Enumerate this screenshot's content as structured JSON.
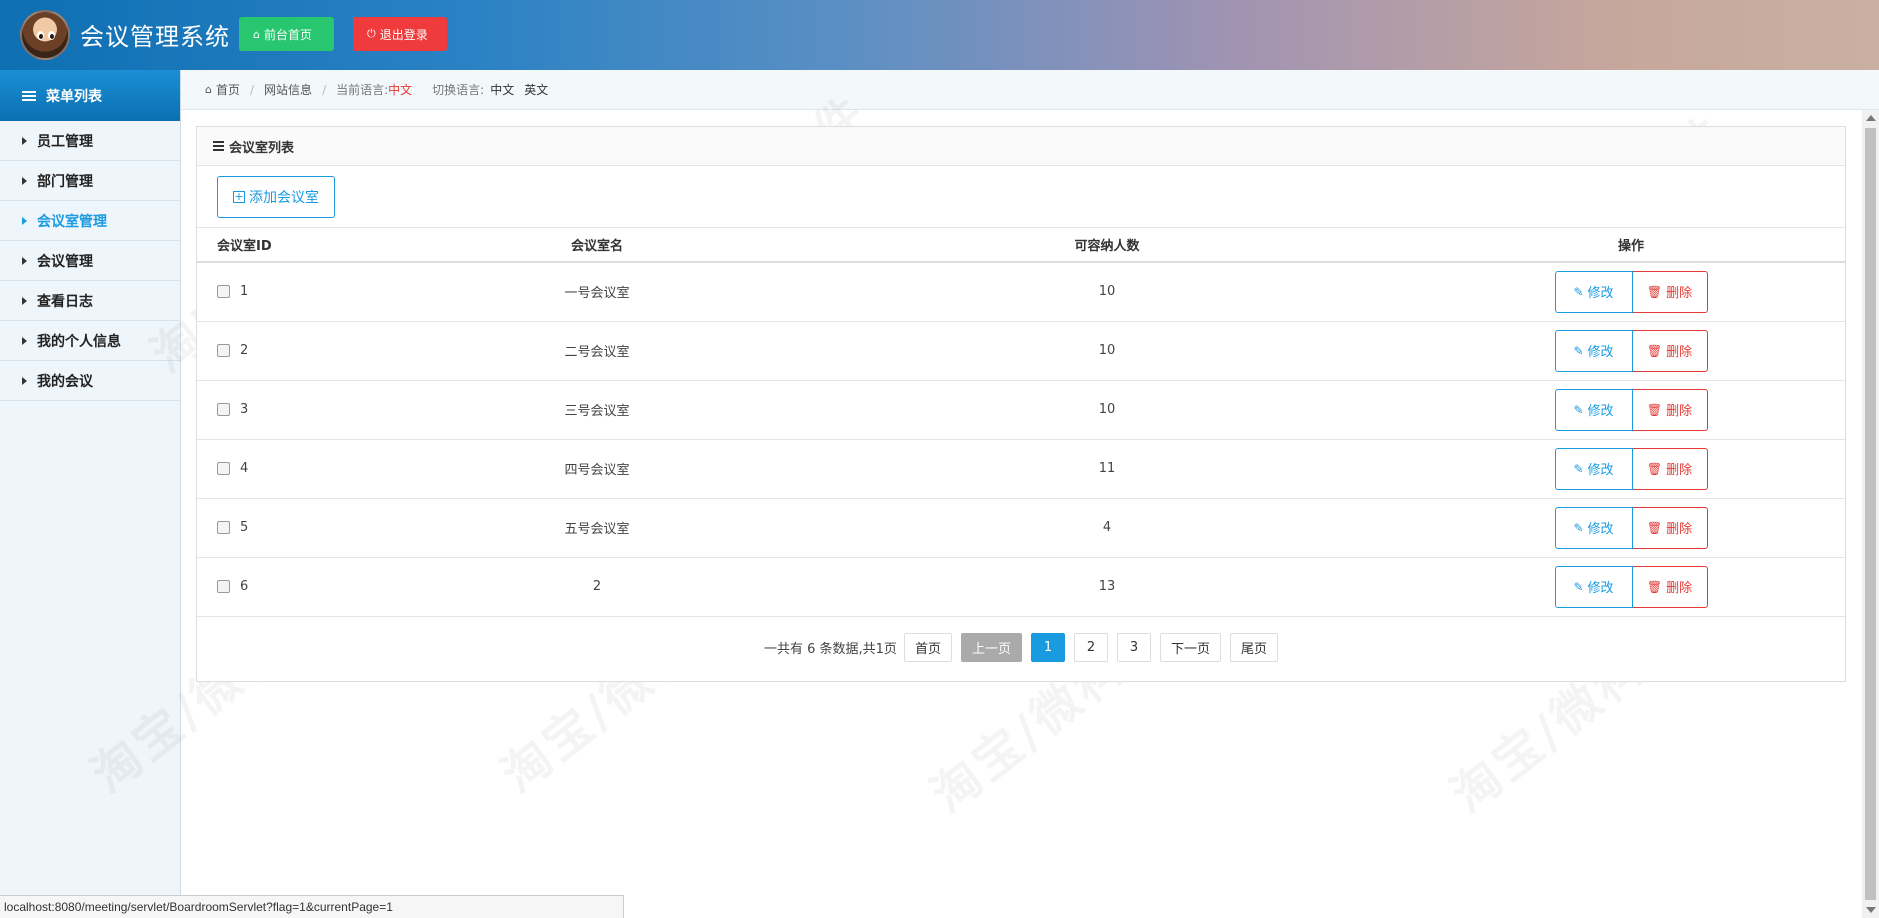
{
  "header": {
    "title": "会议管理系统",
    "home_button": "前台首页",
    "logout_button": "退出登录"
  },
  "sidebar": {
    "heading": "菜单列表",
    "items": [
      {
        "label": "员工管理"
      },
      {
        "label": "部门管理"
      },
      {
        "label": "会议室管理",
        "active": true
      },
      {
        "label": "会议管理"
      },
      {
        "label": "查看日志"
      },
      {
        "label": "我的个人信息"
      },
      {
        "label": "我的会议"
      }
    ]
  },
  "breadcrumb": {
    "home": "首页",
    "site_info": "网站信息",
    "current_lang_label": "当前语言:",
    "current_lang": "中文",
    "switch_label": "切换语言:",
    "lang_zh": "中文",
    "lang_en": "英文"
  },
  "panel": {
    "title": "会议室列表",
    "add_button": "添加会议室",
    "columns": [
      "会议室ID",
      "会议室名",
      "可容纳人数",
      "操作"
    ],
    "rows": [
      {
        "id": "1",
        "name": "一号会议室",
        "capacity": "10"
      },
      {
        "id": "2",
        "name": "二号会议室",
        "capacity": "10"
      },
      {
        "id": "3",
        "name": "三号会议室",
        "capacity": "10"
      },
      {
        "id": "4",
        "name": "四号会议室",
        "capacity": "11"
      },
      {
        "id": "5",
        "name": "五号会议室",
        "capacity": "4"
      },
      {
        "id": "6",
        "name": "2",
        "capacity": "13"
      }
    ],
    "edit_label": "修改",
    "delete_label": "删除"
  },
  "pager": {
    "summary": "一共有 6 条数据,共1页",
    "first": "首页",
    "prev": "上一页",
    "pages": [
      "1",
      "2",
      "3"
    ],
    "current_page": "1",
    "next": "下一页",
    "last": "尾页"
  },
  "status_url": "localhost:8080/meeting/servlet/BoardroomServlet?flag=1&currentPage=1",
  "watermark": "淘宝/微科软件",
  "colors": {
    "accent": "#1a9be0",
    "danger": "#e53935",
    "success": "#28c76f"
  }
}
